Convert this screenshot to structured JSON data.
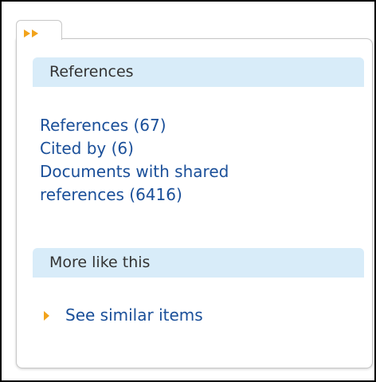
{
  "sections": {
    "references": {
      "title": "References",
      "links": [
        {
          "label": "References",
          "count": "(67)"
        },
        {
          "label": "Cited by",
          "count": "(6)"
        },
        {
          "label_line1": "Documents with shared",
          "label_line2": "references",
          "count": "(6416)"
        }
      ]
    },
    "more_like_this": {
      "title": "More like this",
      "see_similar_label": "See similar items"
    }
  },
  "icons": {
    "expand_tab": "double-chevron-right-icon",
    "see_similar_bullet": "triangle-right-icon"
  },
  "colors": {
    "header_bg": "#d8ecf9",
    "link": "#1a4f99",
    "accent_orange": "#f2a31b",
    "panel_border": "#c7c7c7"
  }
}
